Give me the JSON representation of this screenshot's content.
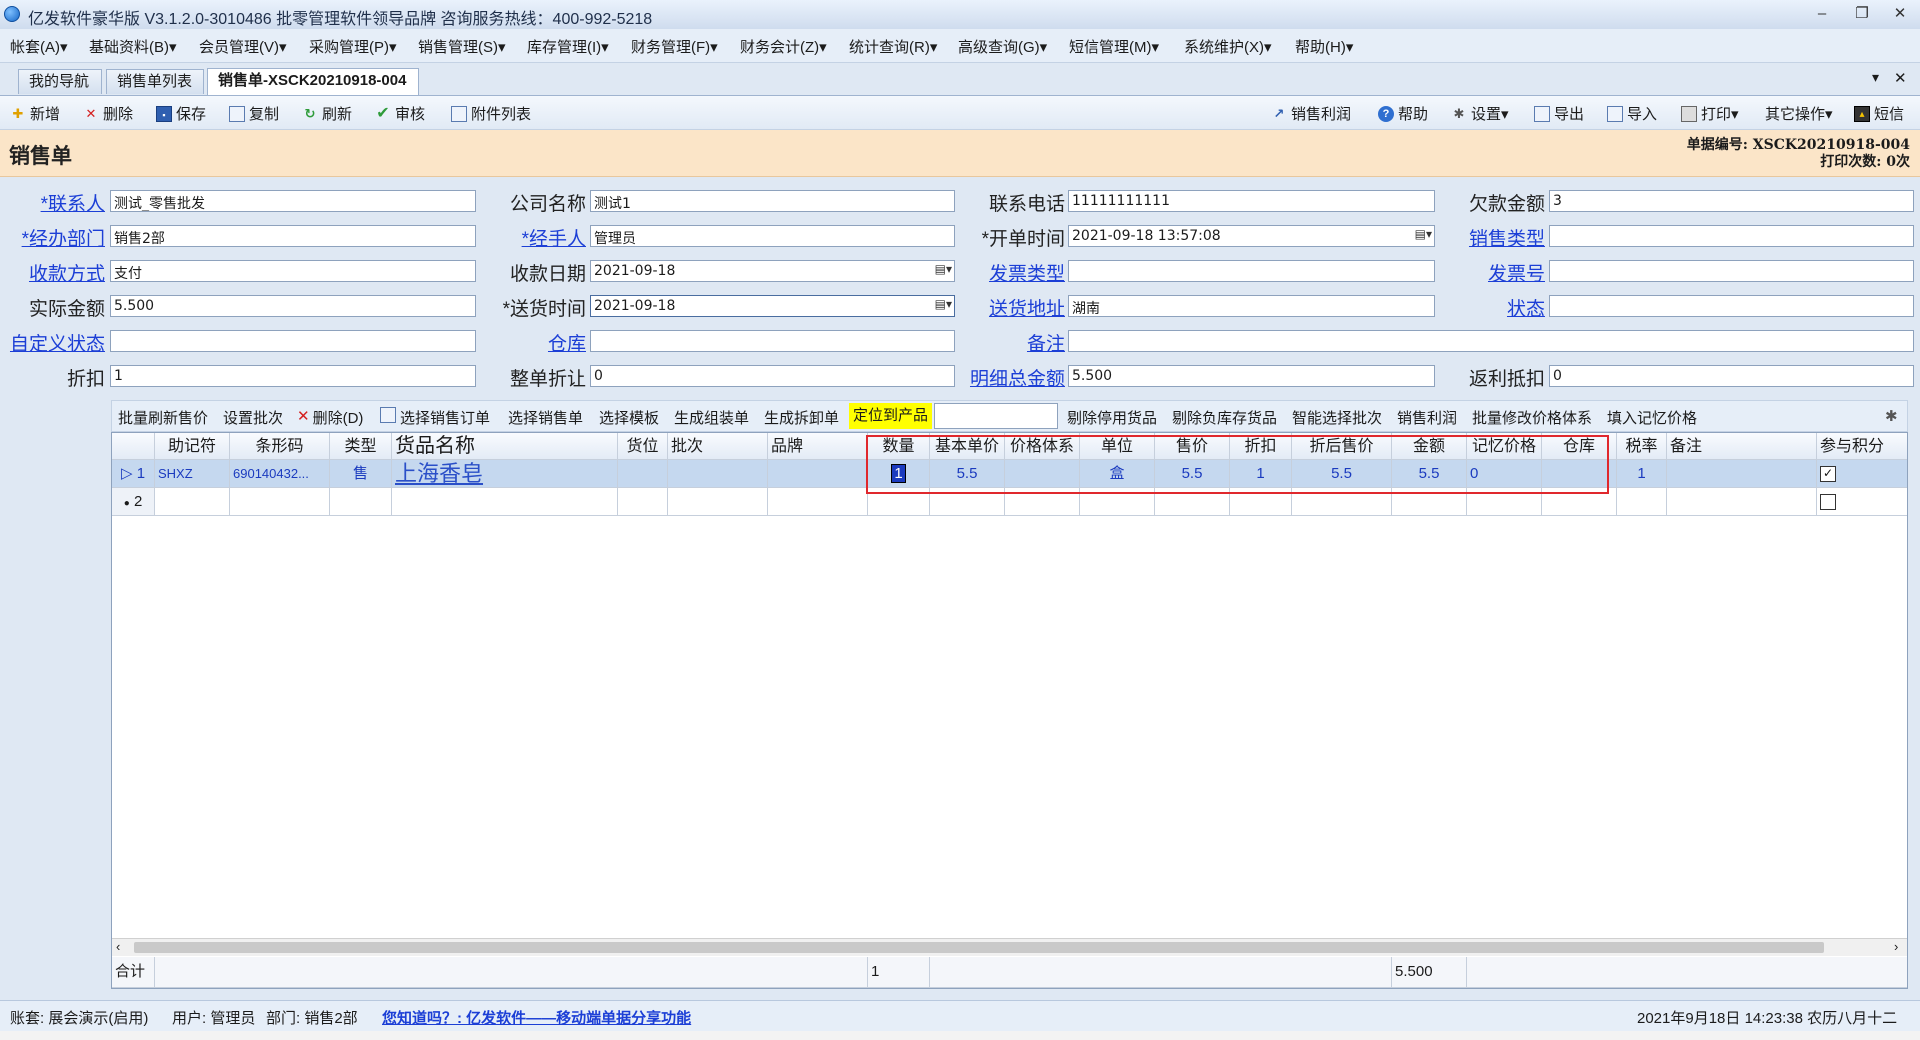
{
  "window": {
    "title": "亿发软件豪华版 V3.1.2.0-3010486 批零管理软件领导品牌 咨询服务热线：400-992-5218",
    "controls": {
      "minimize": "–",
      "restore": "❐",
      "close": "✕"
    }
  },
  "menu": [
    "帐套(A)▾",
    "基础资料(B)▾",
    "会员管理(V)▾",
    "采购管理(P)▾",
    "销售管理(S)▾",
    "库存管理(I)▾",
    "财务管理(F)▾",
    "财务会计(Z)▾",
    "统计查询(R)▾",
    "高级查询(G)▾",
    "短信管理(M)▾",
    "系统维护(X)▾",
    "帮助(H)▾"
  ],
  "tabs": [
    "我的导航",
    "销售单列表",
    "销售单-XSCK20210918-004"
  ],
  "tab_controls": {
    "menu": "▾",
    "close": "✕"
  },
  "toolbar": {
    "new": "新增",
    "delete": "删除",
    "save": "保存",
    "copy": "复制",
    "refresh": "刷新",
    "audit": "审核",
    "attachments": "附件列表",
    "profit": "销售利润",
    "help": "帮助",
    "settings": "设置▾",
    "export": "导出",
    "import": "导入",
    "print": "打印▾",
    "other": "其它操作▾",
    "sms": "短信"
  },
  "form_title": "销售单",
  "doc_info": {
    "number": "单据编号: XSCK20210918-004",
    "print_count": "打印次数: 0次"
  },
  "fields": {
    "contact": {
      "label": "*联系人",
      "value": "测试_零售批发"
    },
    "company": {
      "label": "公司名称",
      "value": "测试1"
    },
    "phone": {
      "label": "联系电话",
      "value": "11111111111"
    },
    "debt": {
      "label": "欠款金额",
      "value": "3"
    },
    "dept": {
      "label": "*经办部门",
      "value": "销售2部"
    },
    "handler": {
      "label": "*经手人",
      "value": "管理员"
    },
    "open_time": {
      "label": "*开单时间",
      "value": "2021-09-18 13:57:08"
    },
    "sales_type": {
      "label": "销售类型",
      "value": ""
    },
    "pay_method": {
      "label": "收款方式",
      "value": "支付"
    },
    "pay_date": {
      "label": "收款日期",
      "value": "2021-09-18"
    },
    "invoice_type": {
      "label": "发票类型",
      "value": ""
    },
    "invoice_no": {
      "label": "发票号",
      "value": ""
    },
    "actual_amount": {
      "label": "实际金额",
      "value": "5.500"
    },
    "delivery_time": {
      "label": "*送货时间",
      "value": "2021-09-18"
    },
    "delivery_addr": {
      "label": "送货地址",
      "value": "湖南"
    },
    "status": {
      "label": "状态",
      "value": ""
    },
    "custom_status": {
      "label": "自定义状态",
      "value": ""
    },
    "warehouse": {
      "label": "仓库",
      "value": ""
    },
    "remark": {
      "label": "备注",
      "value": ""
    },
    "discount": {
      "label": "折扣",
      "value": "1"
    },
    "whole_discount": {
      "label": "整单折让",
      "value": "0"
    },
    "detail_total": {
      "label": "明细总金额",
      "value": "5.500"
    },
    "rebate": {
      "label": "返利抵扣",
      "value": "0"
    }
  },
  "grid_toolbar": {
    "batch_refresh_price": "批量刷新售价",
    "set_batch": "设置批次",
    "delete": "删除(D)",
    "select_order": "选择销售订单",
    "select_sale": "选择销售单",
    "select_template": "选择模板",
    "gen_assembly": "生成组装单",
    "gen_disassembly": "生成拆卸单",
    "locate_product": "定位到产品",
    "locate_input": "",
    "remove_disabled": "剔除停用货品",
    "remove_negative": "剔除负库存货品",
    "smart_batch": "智能选择批次",
    "sales_profit": "销售利润",
    "batch_price_system": "批量修改价格体系",
    "fill_memory_price": "填入记忆价格"
  },
  "grid": {
    "columns": [
      "",
      "助记符",
      "条形码",
      "类型",
      "货品名称",
      "货位",
      "批次",
      "品牌",
      "数量",
      "基本单价",
      "价格体系",
      "单位",
      "售价",
      "折扣",
      "折后售价",
      "金额",
      "记忆价格",
      "仓库",
      "税率",
      "备注",
      "参与积分"
    ],
    "rows": [
      {
        "index": "1",
        "cells": [
          "SHXZ",
          "690140432...",
          "售",
          "上海香皂",
          "",
          "",
          "",
          "1",
          "5.5",
          "",
          "盒",
          "5.5",
          "1",
          "5.5",
          "5.5",
          "0",
          "",
          "1",
          ""
        ],
        "points": true
      },
      {
        "index": "2",
        "cells": [
          "",
          "",
          "",
          "",
          "",
          "",
          "",
          "",
          "",
          "",
          "",
          "",
          "",
          "",
          "",
          "",
          "",
          "",
          ""
        ],
        "points": false
      }
    ],
    "footer": {
      "label": "合计",
      "qty": "1",
      "amount": "5.500"
    }
  },
  "status_bar": {
    "account": "账套: 展会演示(启用)",
    "user": "用户: 管理员",
    "dept": "部门: 销售2部",
    "tip": "您知道吗？: 亿发软件——移动端单据分享功能",
    "datetime": "2021年9月18日 14:23:38 农历八月十二"
  },
  "colors": {
    "header_band": "#fbe5c8",
    "selected_row": "#c5d8ef",
    "link": "#1c3fd6",
    "highlight_box": "#e0282d",
    "locate_btn": "#ffff00"
  }
}
